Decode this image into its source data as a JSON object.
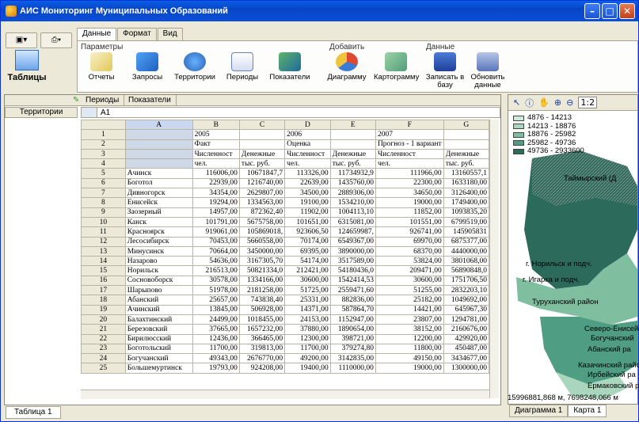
{
  "window": {
    "title": "АИС Мониторинг Муниципальных Образований"
  },
  "ribbon": {
    "tabs": [
      "Данные",
      "Формат",
      "Вид"
    ],
    "active_tab": "Данные",
    "groups": {
      "params": "Параметры",
      "add": "Добавить",
      "data": "Данные"
    },
    "buttons": {
      "tables": "Таблицы",
      "reports": "Отчеты",
      "queries": "Запросы",
      "territories": "Территории",
      "periods": "Периоды",
      "indicators": "Показатели",
      "diagram": "Диаграмму",
      "cartogram": "Картограмму",
      "save_db": "Записать в базу",
      "refresh": "Обновить данные"
    }
  },
  "sheet": {
    "top_tabs": [
      "Периоды",
      "Показатели"
    ],
    "left_header": "Территории",
    "cell_ref": "A1",
    "columns": [
      "A",
      "B",
      "C",
      "D",
      "E",
      "F",
      "G"
    ],
    "header_rows": [
      [
        "",
        "2005",
        "",
        "2006",
        "",
        "2007",
        ""
      ],
      [
        "",
        "Факт",
        "",
        "Оценка",
        "",
        "Прогноз - 1 вариант",
        ""
      ],
      [
        "",
        "Численност",
        "Денежные",
        "Численност",
        "Денежные",
        "Численност",
        "Денежные"
      ],
      [
        "",
        "чел.",
        "тыс. руб.",
        "чел.",
        "тыс. руб.",
        "чел.",
        "тыс. руб."
      ]
    ],
    "rows": [
      [
        "Ачинск",
        "116006,00",
        "10671847,7",
        "113326,00",
        "11734932,9",
        "111966,00",
        "13160557,1"
      ],
      [
        "Боготол",
        "22939,00",
        "1216740,00",
        "22639,00",
        "1435760,00",
        "22300,00",
        "1633180,00"
      ],
      [
        "Дивногорск",
        "34354,00",
        "2629807,00",
        "34500,00",
        "2889306,00",
        "34650,00",
        "3126400,00"
      ],
      [
        "Енисейск",
        "19294,00",
        "1334563,00",
        "19100,00",
        "1534210,00",
        "19000,00",
        "1749400,00"
      ],
      [
        "Заозерный",
        "14957,00",
        "872362,40",
        "11902,00",
        "1004113,10",
        "11852,00",
        "1093835,20"
      ],
      [
        "Канск",
        "101791,00",
        "5675758,00",
        "101651,00",
        "6315081,00",
        "101551,00",
        "6799519,00"
      ],
      [
        "Красноярск",
        "919061,00",
        "105869018,",
        "923606,50",
        "124659987,",
        "926741,00",
        "145905831"
      ],
      [
        "Лесосибирск",
        "70453,00",
        "5660558,00",
        "70174,00",
        "6549367,00",
        "69970,00",
        "6875377,00"
      ],
      [
        "Минусинск",
        "70664,00",
        "3450000,00",
        "69395,00",
        "3890000,00",
        "68370,00",
        "4440000,00"
      ],
      [
        "Назарово",
        "54636,00",
        "3167305,70",
        "54174,00",
        "3517589,00",
        "53824,00",
        "3801068,00"
      ],
      [
        "Норильск",
        "216513,00",
        "50821334,0",
        "212421,00",
        "54180436,0",
        "209471,00",
        "56890848,0"
      ],
      [
        "Сосновоборск",
        "30578,00",
        "1334166,00",
        "30600,00",
        "1542414,53",
        "30600,00",
        "1751706,50"
      ],
      [
        "Шарыпово",
        "51978,00",
        "2181258,00",
        "51725,00",
        "2559471,60",
        "51255,00",
        "2832203,10"
      ],
      [
        "Абанский",
        "25657,00",
        "743838,40",
        "25331,00",
        "882836,00",
        "25182,00",
        "1049692,00"
      ],
      [
        "Ачинский",
        "13845,00",
        "506928,00",
        "14371,00",
        "587864,70",
        "14421,00",
        "645967,30"
      ],
      [
        "Балахтинский",
        "24499,00",
        "1018455,00",
        "24153,00",
        "1152947,00",
        "23807,00",
        "1294781,00"
      ],
      [
        "Березовский",
        "37665,00",
        "1657232,00",
        "37880,00",
        "1890654,00",
        "38152,00",
        "2160676,00"
      ],
      [
        "Бирилюсский",
        "12436,00",
        "366465,00",
        "12300,00",
        "398721,00",
        "12200,00",
        "429920,00"
      ],
      [
        "Боготольский",
        "11700,00",
        "319813,00",
        "11700,00",
        "379274,80",
        "11800,00",
        "450487,00"
      ],
      [
        "Богучанский",
        "49343,00",
        "2676770,00",
        "49200,00",
        "3142835,00",
        "49150,00",
        "3434677,00"
      ],
      [
        "Большемуртинск",
        "19793,00",
        "924208,00",
        "19400,00",
        "1110000,00",
        "19000,00",
        "1300000,00"
      ]
    ]
  },
  "bottom_tab": "Таблица 1",
  "map": {
    "legend": [
      {
        "label": "4876 - 14213",
        "color": "#cfe8d8"
      },
      {
        "label": "14213 - 18876",
        "color": "#a9d6bd"
      },
      {
        "label": "18876 - 25982",
        "color": "#7fbfa0"
      },
      {
        "label": "25982 - 49736",
        "color": "#4f9d83"
      },
      {
        "label": "49736 - 2933600",
        "color": "#2c6b5b"
      }
    ],
    "labels": {
      "taimyr": "Таймырский (Д",
      "norilsk": "г. Норильск и подч.",
      "igarka": "г. Игарка и подч.",
      "turukhansk": "Туруханский район",
      "severo": "Северо-Енисейс",
      "boguchan": "Богучанский",
      "aban": "Абанский ра",
      "kazach": "Казачинский райо",
      "irbei": "Ирбейский ра",
      "ermak": "Ермаковский рай"
    },
    "zoom_partial": "1:2",
    "coords": "15996881,868 м,  7698248,066 м",
    "tabs": [
      "Диаграмма 1",
      "Карта 1"
    ]
  }
}
